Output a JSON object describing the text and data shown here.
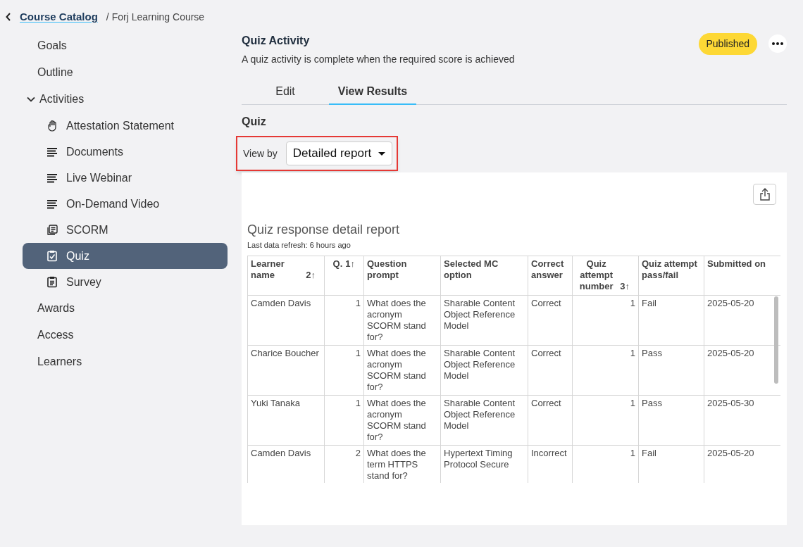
{
  "breadcrumb": {
    "back": "Course Catalog",
    "current": "/ Forj Learning Course"
  },
  "sidebar": {
    "items": [
      {
        "kind": "link",
        "label": "Goals",
        "selected": false
      },
      {
        "kind": "link",
        "label": "Outline",
        "selected": false
      },
      {
        "kind": "group",
        "label": "Activities",
        "expanded": true,
        "selected": false,
        "children": [
          {
            "kind": "attestation",
            "label": "Attestation Statement",
            "selected": false
          },
          {
            "kind": "content",
            "label": "Documents",
            "selected": false
          },
          {
            "kind": "content",
            "label": "Live Webinar",
            "selected": false
          },
          {
            "kind": "content",
            "label": "On-Demand Video",
            "selected": false
          },
          {
            "kind": "scorm",
            "label": "SCORM",
            "selected": false
          },
          {
            "kind": "quiz",
            "label": "Quiz",
            "selected": true
          },
          {
            "kind": "survey",
            "label": "Survey",
            "selected": false
          }
        ]
      },
      {
        "kind": "link",
        "label": "Awards",
        "selected": false
      },
      {
        "kind": "link",
        "label": "Access",
        "selected": false
      },
      {
        "kind": "link",
        "label": "Learners",
        "selected": false
      }
    ]
  },
  "header": {
    "title": "Quiz Activity",
    "description": "A quiz activity is complete when the required score is achieved",
    "status": "Published"
  },
  "tabs": [
    {
      "label": "Edit",
      "selected": false
    },
    {
      "label": "View Results",
      "selected": true
    }
  ],
  "section_title": "Quiz",
  "view_by": {
    "label": "View by",
    "value": "Detailed report",
    "highlighted": true
  },
  "report": {
    "title": "Quiz response detail report",
    "refresh": "Last data refresh: 6 hours ago",
    "columns": [
      {
        "label": "Learner name",
        "sort": "2↑",
        "kind": "text"
      },
      {
        "label": "Q.",
        "sort": "1↑",
        "kind": "number"
      },
      {
        "label": "Question prompt",
        "kind": "text"
      },
      {
        "label": "Selected MC option",
        "kind": "text"
      },
      {
        "label": "Correct answer",
        "kind": "text"
      },
      {
        "label": "Quiz attempt number",
        "sort": "3↑",
        "kind": "number"
      },
      {
        "label": "Quiz attempt pass/fail",
        "kind": "text"
      },
      {
        "label": "Submitted on",
        "kind": "text"
      }
    ],
    "rows": [
      [
        "Camden Davis",
        "1",
        "What does the acronym SCORM stand for?",
        "Sharable Content Object Reference Model",
        "Correct",
        "1",
        "Fail",
        "2025-05-20"
      ],
      [
        "Charice Boucher",
        "1",
        "What does the acronym SCORM stand for?",
        "Sharable Content Object Reference Model",
        "Correct",
        "1",
        "Pass",
        "2025-05-20"
      ],
      [
        "Yuki Tanaka",
        "1",
        "What does the acronym SCORM stand for?",
        "Sharable Content Object Reference Model",
        "Correct",
        "1",
        "Pass",
        "2025-05-30"
      ],
      [
        "Camden Davis",
        "2",
        "What does the term HTTPS stand for?",
        "Hypertext Timing Protocol Secure",
        "Incorrect",
        "1",
        "Fail",
        "2025-05-20"
      ]
    ]
  }
}
